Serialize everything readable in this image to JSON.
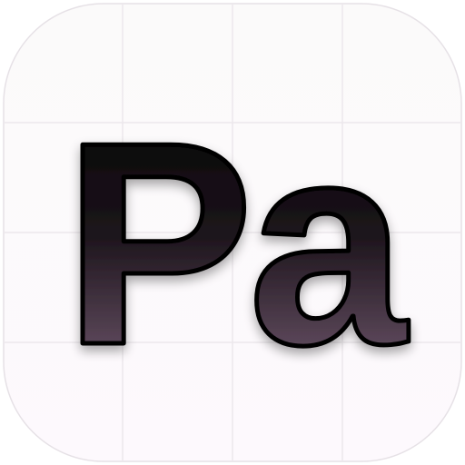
{
  "icon": {
    "glyph": "Pa",
    "background_color": "#fbfafa",
    "background_bottom_color": "#fdf9fd",
    "grid_color": "#ece8ec",
    "border_color": "#e6e1e6",
    "glyph_top_color": "#0a080a",
    "glyph_bottom_color": "#5a4658",
    "glyph_outline_color": "#000000"
  }
}
